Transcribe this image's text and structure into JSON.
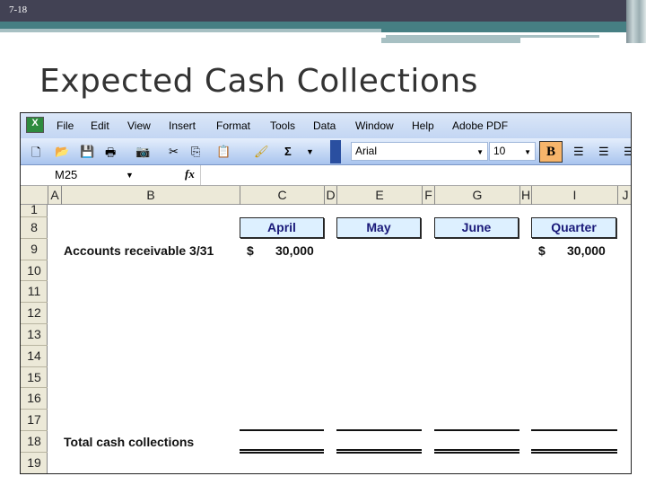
{
  "slide": {
    "number": "7-18",
    "title": "Expected Cash Collections"
  },
  "excel": {
    "menu": [
      "File",
      "Edit",
      "View",
      "Insert",
      "Format",
      "Tools",
      "Data",
      "Window",
      "Help",
      "Adobe PDF"
    ],
    "font": "Arial",
    "font_size": "10",
    "bold_label": "B",
    "name_box": "M25",
    "fx_label": "fx",
    "columns": [
      "A",
      "B",
      "C",
      "D",
      "E",
      "F",
      "G",
      "H",
      "I",
      "J"
    ],
    "rows": [
      "1",
      "8",
      "9",
      "10",
      "11",
      "12",
      "13",
      "14",
      "15",
      "16",
      "17",
      "18",
      "19"
    ],
    "headers": {
      "april": "April",
      "may": "May",
      "june": "June",
      "quarter": "Quarter"
    },
    "ar_label": "Accounts receivable 3/31",
    "ar_april_currency": "$",
    "ar_april": "30,000",
    "ar_quarter_currency": "$",
    "ar_quarter": "30,000",
    "total_label": "Total cash collections"
  }
}
